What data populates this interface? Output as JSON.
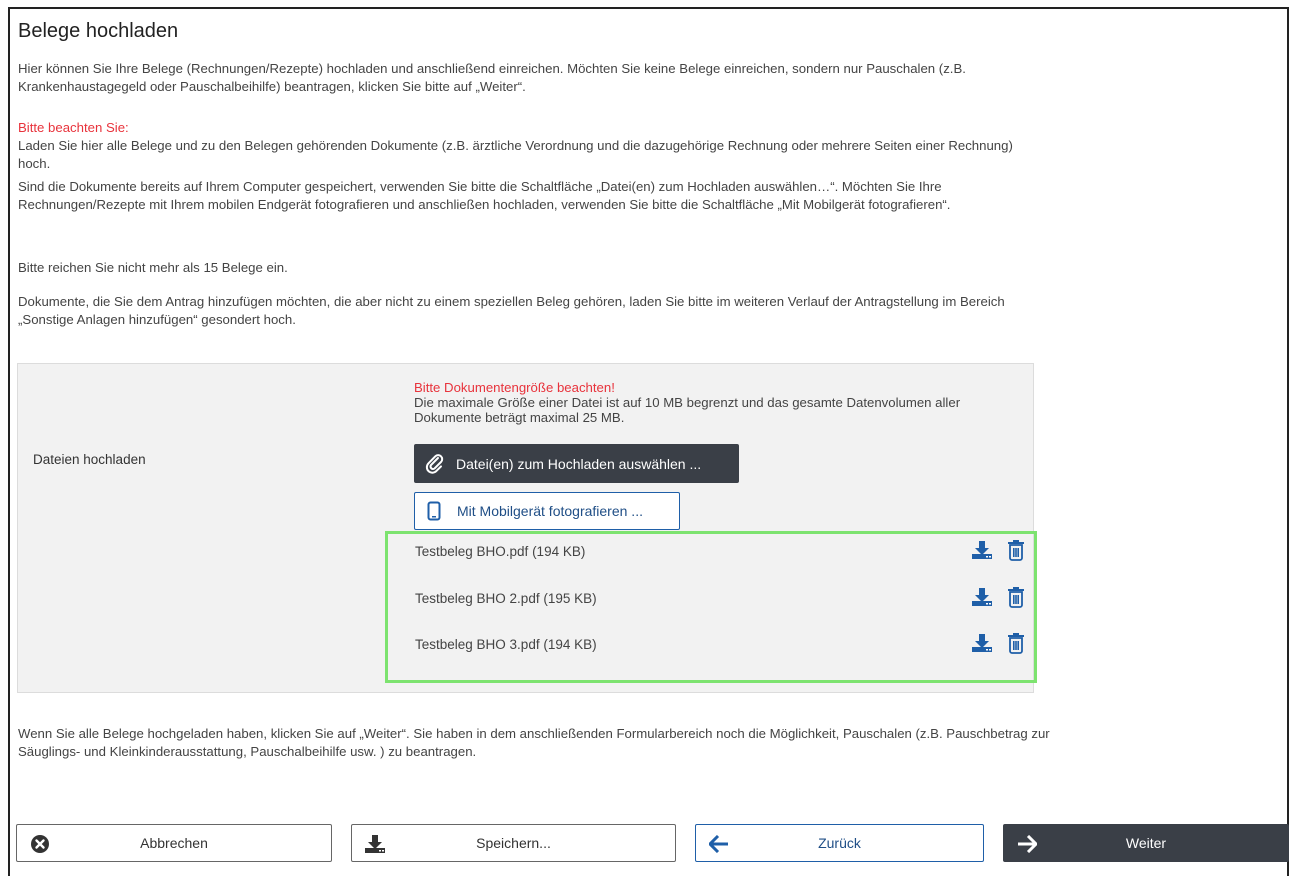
{
  "page": {
    "title": "Belege hochladen",
    "intro": "Hier können Sie Ihre Belege (Rechnungen/Rezepte) hochladen und anschließend einreichen. Möchten Sie keine Belege einreichen, sondern nur Pauschalen (z.B. Krankenhaustagegeld oder Pauschalbeihilfe) beantragen, klicken Sie bitte auf „Weiter“.",
    "notice_heading": "Bitte beachten Sie:",
    "notice_line1": "Laden Sie hier alle Belege und zu den Belegen gehörenden Dokumente (z.B. ärztliche Verordnung und die dazugehörige Rechnung oder mehrere Seiten einer Rechnung) hoch.",
    "notice_line2": "Sind die Dokumente bereits auf Ihrem Computer gespeichert, verwenden Sie bitte die Schaltfläche „Datei(en) zum Hochladen auswählen…“. Möchten Sie Ihre Rechnungen/Rezepte mit Ihrem mobilen Endgerät fotografieren und anschließen hochladen, verwenden Sie bitte die Schaltfläche „Mit Mobilgerät fotografieren“.",
    "limit_text": "Bitte reichen Sie nicht mehr als 15 Belege ein.",
    "other_docs_text": "Dokumente, die Sie dem Antrag hinzufügen möchten, die aber nicht zu einem speziellen Beleg gehören, laden Sie bitte im weiteren Verlauf der Antragstellung im Bereich „Sonstige Anlagen hinzufügen“ gesondert hoch."
  },
  "upload": {
    "label": "Dateien hochladen",
    "size_warning": "Bitte Dokumentengröße beachten!",
    "size_info": "Die maximale Größe einer Datei ist auf 10 MB begrenzt und das gesamte Datenvolumen aller Dokumente beträgt maximal 25 MB.",
    "select_button": "Datei(en) zum Hochladen auswählen ...",
    "mobile_button": "Mit Mobilgerät fotografieren ...",
    "files": [
      {
        "name": "Testbeleg BHO.pdf (194 KB)"
      },
      {
        "name": "Testbeleg BHO 2.pdf (195 KB)"
      },
      {
        "name": "Testbeleg BHO 3.pdf (194 KB)"
      }
    ]
  },
  "footer": {
    "text": "Wenn Sie alle Belege hochgeladen haben, klicken Sie auf „Weiter“. Sie haben in dem anschließenden Formularbereich noch die Möglichkeit, Pauschalen (z.B. Pauschbetrag zur Säuglings- und Kleinkinderausstattung, Pauschalbeihilfe usw. ) zu beantragen.",
    "cancel": "Abbrechen",
    "save": "Speichern...",
    "back": "Zurück",
    "next": "Weiter"
  },
  "colors": {
    "accent_blue": "#1f5fa8",
    "dark_button": "#3a3f47",
    "warning_red": "#e8333c",
    "highlight_green": "#7de36f"
  }
}
